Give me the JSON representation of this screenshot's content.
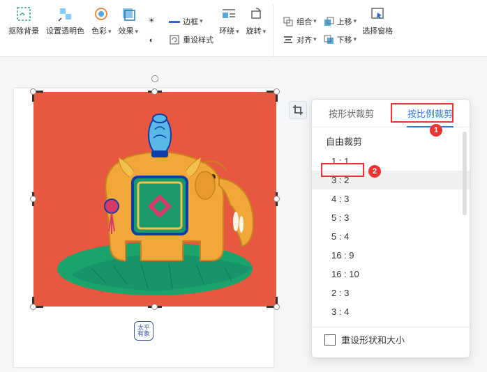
{
  "ribbon": {
    "remove_bg": "抠除背景",
    "transparent": "设置透明色",
    "color": "色彩",
    "effect": "效果",
    "border": "边框",
    "reset_style": "重设样式",
    "wrap": "环绕",
    "rotate": "旋转",
    "combine": "组合",
    "align": "对齐",
    "move_up": "上移",
    "move_down": "下移",
    "select_pane": "选择窗格"
  },
  "stamp": "太平有象",
  "popup": {
    "tab_shape": "按形状裁剪",
    "tab_ratio": "按比例裁剪",
    "free": "自由裁剪",
    "ratios": [
      "1 : 1",
      "3 : 2",
      "4 : 3",
      "5 : 3",
      "5 : 4",
      "16 : 9",
      "16 : 10",
      "2 : 3",
      "3 : 4"
    ],
    "reset": "重设形状和大小"
  },
  "anno": {
    "n1": "1",
    "n2": "2"
  }
}
